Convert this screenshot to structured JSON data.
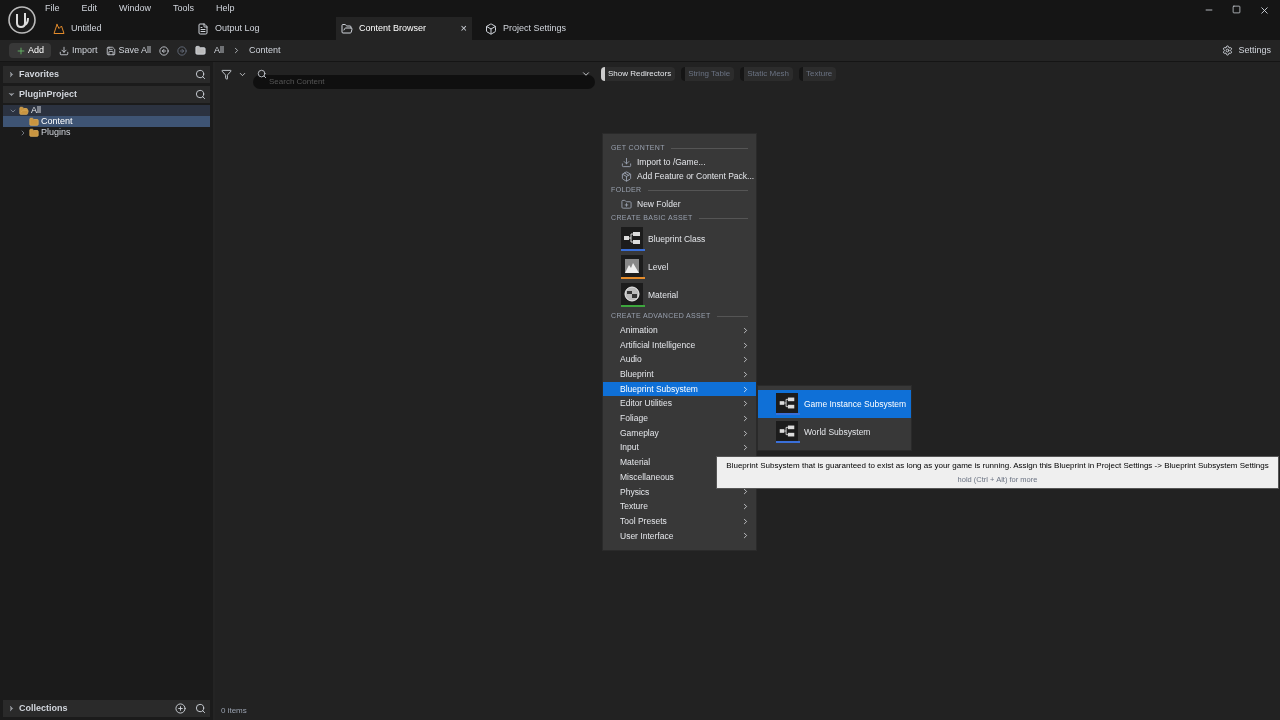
{
  "menu_bar": [
    "File",
    "Edit",
    "Window",
    "Tools",
    "Help"
  ],
  "tabs": [
    {
      "label": "Untitled",
      "kind": "level",
      "selected": false
    },
    {
      "label": "Output Log",
      "kind": "log",
      "selected": false
    },
    {
      "label": "Content Browser",
      "kind": "browser",
      "selected": true,
      "close": "×"
    },
    {
      "label": "Project Settings",
      "kind": "settings",
      "selected": false
    }
  ],
  "toolbar": {
    "add": "Add",
    "import": "Import",
    "save_all": "Save All",
    "breadcrumbs": [
      "All",
      "Content"
    ],
    "settings": "Settings"
  },
  "sidebar": {
    "favorites": {
      "title": "Favorites",
      "expanded": false
    },
    "project": {
      "title": "PluginProject",
      "expanded": true,
      "tree": [
        {
          "label": "All",
          "expanded": true,
          "selected": false,
          "children": [
            {
              "label": "Content",
              "selected": true
            },
            {
              "label": "Plugins",
              "expanded": false,
              "selected": false
            }
          ]
        }
      ]
    },
    "collections": {
      "title": "Collections",
      "expanded": false
    }
  },
  "filter_bar": {
    "search": {
      "placeholder": "Search Content"
    },
    "filters": [
      {
        "label": "Show Redirectors",
        "on": true
      },
      {
        "label": "String Table",
        "on": false
      },
      {
        "label": "Static Mesh",
        "on": false
      },
      {
        "label": "Texture",
        "on": false
      }
    ]
  },
  "status": "0 items",
  "context_menu": {
    "sections": [
      {
        "heading": "GET CONTENT",
        "items": [
          {
            "kind": "action",
            "label": "Import to /Game..."
          },
          {
            "kind": "action",
            "label": "Add Feature or Content Pack..."
          }
        ]
      },
      {
        "heading": "FOLDER",
        "items": [
          {
            "kind": "action",
            "label": "New Folder"
          }
        ]
      },
      {
        "heading": "CREATE BASIC ASSET",
        "items": [
          {
            "kind": "asset",
            "label": "Blueprint Class",
            "color": "#3a6fd8"
          },
          {
            "kind": "asset",
            "label": "Level",
            "color": "#e38b2b"
          },
          {
            "kind": "asset",
            "label": "Material",
            "color": "#3da63d"
          }
        ]
      },
      {
        "heading": "CREATE ADVANCED ASSET",
        "items": [
          {
            "kind": "submenu",
            "label": "Animation",
            "selected": false
          },
          {
            "kind": "submenu",
            "label": "Artificial Intelligence",
            "selected": false
          },
          {
            "kind": "submenu",
            "label": "Audio",
            "selected": false
          },
          {
            "kind": "submenu",
            "label": "Blueprint",
            "selected": false
          },
          {
            "kind": "submenu",
            "label": "Blueprint Subsystem",
            "selected": true
          },
          {
            "kind": "submenu",
            "label": "Editor Utilities",
            "selected": false
          },
          {
            "kind": "submenu",
            "label": "Foliage",
            "selected": false
          },
          {
            "kind": "submenu",
            "label": "Gameplay",
            "selected": false
          },
          {
            "kind": "submenu",
            "label": "Input",
            "selected": false
          },
          {
            "kind": "submenu",
            "label": "Material",
            "selected": false
          },
          {
            "kind": "submenu",
            "label": "Miscellaneous",
            "selected": false
          },
          {
            "kind": "submenu",
            "label": "Physics",
            "selected": false
          },
          {
            "kind": "submenu",
            "label": "Texture",
            "selected": false
          },
          {
            "kind": "submenu",
            "label": "Tool Presets",
            "selected": false
          },
          {
            "kind": "submenu",
            "label": "User Interface",
            "selected": false
          }
        ]
      }
    ]
  },
  "submenu": {
    "items": [
      {
        "label": "Game Instance Subsystem",
        "selected": true
      },
      {
        "label": "World Subsystem",
        "selected": false
      }
    ]
  },
  "tooltip": {
    "text": "Blueprint Subsystem that is guaranteed to exist as long as your game is running. Assign this Blueprint in Project Settings -> Blueprint Subsystem Settings",
    "hint": "hold (Ctrl + Alt) for more"
  }
}
